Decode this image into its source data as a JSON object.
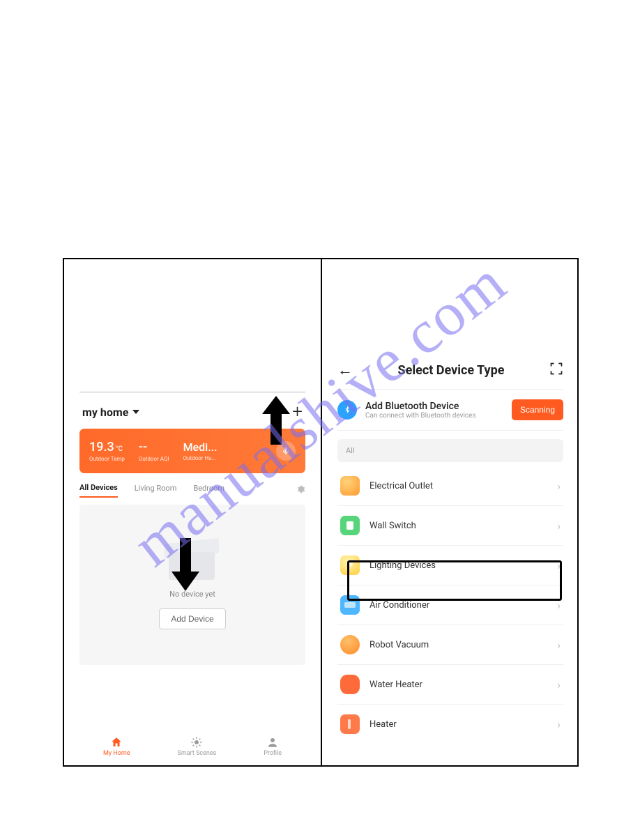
{
  "watermark": "manualshive.com",
  "left": {
    "home_title": "my home",
    "weather": {
      "temp_value": "19.3",
      "temp_unit": "°C",
      "temp_label": "Outdoor Temp",
      "aqi_value": "--",
      "aqi_label": "Outdoor AQI",
      "hum_value": "Medi...",
      "hum_label": "Outdoor Hu..."
    },
    "room_tabs": {
      "all": "All Devices",
      "living": "Living Room",
      "bed": "Bedroom"
    },
    "empty_text": "No device yet",
    "add_device_btn": "Add Device",
    "nav": {
      "home": "My Home",
      "scenes": "Smart Scenes",
      "profile": "Profile"
    }
  },
  "right": {
    "title": "Select Device Type",
    "bt_title": "Add Bluetooth Device",
    "bt_sub": "Can connect with Bluetooth devices",
    "scanning": "Scanning",
    "all_label": "All",
    "devices": {
      "outlet": "Electrical Outlet",
      "switch": "Wall Switch",
      "light": "Lighting Devices",
      "ac": "Air Conditioner",
      "vacuum": "Robot Vacuum",
      "waterheater": "Water Heater",
      "heater": "Heater"
    }
  }
}
